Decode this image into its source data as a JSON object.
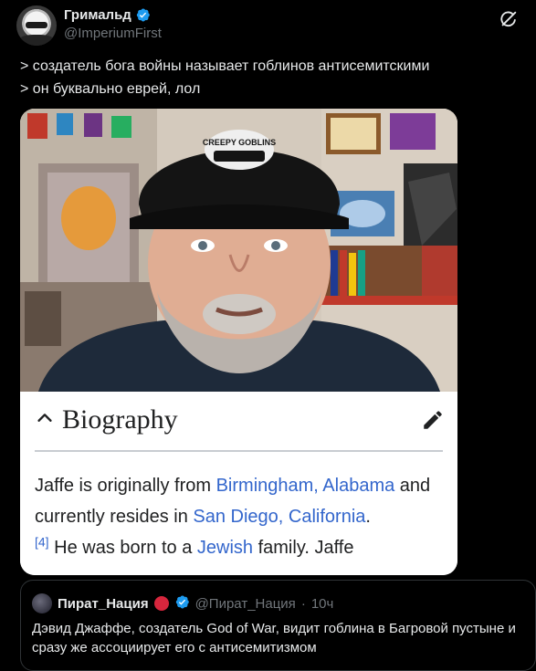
{
  "author": {
    "display_name": "Гримальд",
    "handle": "@ImperiumFirst"
  },
  "tweet": {
    "lines": [
      "> создатель бога войны называет гоблинов антисемитскими",
      "> он буквально еврей, лол"
    ]
  },
  "media": {
    "photo_cap_text": "CREEPY GOBLINS",
    "biography": {
      "title": "Biography",
      "text_1": "Jaffe is originally from ",
      "link_1": "Birmingham, Alabama",
      "text_2": " and currently resides in ",
      "link_2": "San Diego, California",
      "text_3": ".",
      "ref": "[4]",
      "text_4": " He was born to a ",
      "link_3": "Jewish",
      "text_5": " family. Jaffe"
    }
  },
  "quote": {
    "display_name": "Пират_Нация",
    "handle": "@Пират_Нация",
    "separator": "·",
    "time": "10ч",
    "text": "Дэвид Джаффе, создатель God of War, видит гоблина в Багровой пустыне и сразу же ассоциирует его с антисемитизмом"
  },
  "colors": {
    "background": "#000000",
    "verified_badge": "#1d9bf0",
    "link": "#3366cc",
    "secondary_text": "#71767b"
  },
  "icons": [
    "verified-badge-icon",
    "grok-icon",
    "chevron-up-icon",
    "pencil-icon"
  ]
}
